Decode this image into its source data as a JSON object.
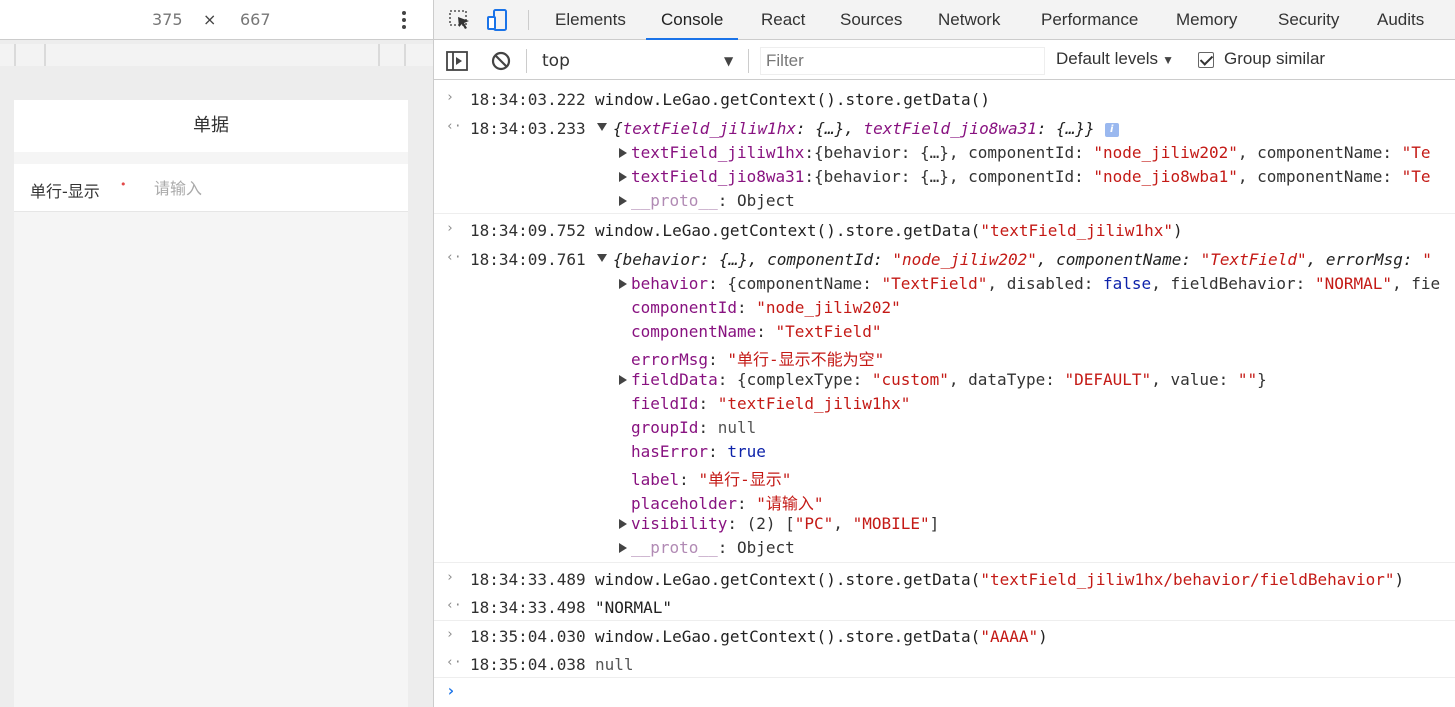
{
  "device": {
    "width": "375",
    "times": "×",
    "height": "667"
  },
  "app": {
    "header_title": "单据",
    "field_label": "单行-显示",
    "required_mark": "•",
    "field_placeholder": "请输入"
  },
  "devtools": {
    "tabs": [
      {
        "label": "Elements"
      },
      {
        "label": "Console"
      },
      {
        "label": "React"
      },
      {
        "label": "Sources"
      },
      {
        "label": "Network"
      },
      {
        "label": "Performance"
      },
      {
        "label": "Memory"
      },
      {
        "label": "Security"
      },
      {
        "label": "Audits"
      }
    ],
    "active_tab": "Console",
    "context": "top",
    "filter_placeholder": "Filter",
    "levels": "Default levels",
    "group_similar": "Group similar",
    "group_similar_checked": true
  },
  "console": {
    "entries": [
      {
        "in_time": "18:34:03.222",
        "command": "window.LeGao.getContext().store.getData()",
        "out_time": "18:34:03.233",
        "summary": [
          "{",
          "textField_jiliw1hx",
          ": {…}, ",
          "textField_jio8wa31",
          ": {…}}"
        ],
        "info": "i",
        "props": [
          {
            "key": "textField_jiliw1hx",
            "rest": ":{behavior: {…}, componentId: ",
            "str1": "\"node_jiliw202\"",
            "rest2": ", componentName: ",
            "str2": "\"Te"
          },
          {
            "key": "textField_jio8wa31",
            "rest": ":{behavior: {…}, componentId: ",
            "str1": "\"node_jio8wba1\"",
            "rest2": ", componentName: ",
            "str2": "\"Te"
          },
          {
            "key": "__proto__",
            "rest": ": Object"
          }
        ]
      },
      {
        "in_time": "18:34:09.752",
        "command": "window.LeGao.getContext().store.getData(",
        "command_arg": "\"textField_jiliw1hx\"",
        "command_end": ")",
        "out_time": "18:34:09.761",
        "summary": {
          "a": "{behavior: {…}, componentId: ",
          "b": "\"node_jiliw202\"",
          "c": ", componentName: ",
          "d": "\"TextField\"",
          "e": ", errorMsg: ",
          "f": "\""
        },
        "behavior": {
          "key": "behavior",
          "a": ": {componentName: ",
          "b": "\"TextField\"",
          "c": ", disabled: ",
          "d": "false",
          "e": ", fieldBehavior: ",
          "f": "\"NORMAL\"",
          "g": ", fie"
        },
        "componentId": {
          "key": "componentId",
          "val": "\"node_jiliw202\""
        },
        "componentName": {
          "key": "componentName",
          "val": "\"TextField\""
        },
        "errorMsg": {
          "key": "errorMsg",
          "val": "\"单行-显示不能为空\""
        },
        "fieldData": {
          "key": "fieldData",
          "a": ": {complexType: ",
          "b": "\"custom\"",
          "c": ", dataType: ",
          "d": "\"DEFAULT\"",
          "e": ", value: ",
          "f": "\"\"",
          "g": "}"
        },
        "fieldId": {
          "key": "fieldId",
          "val": "\"textField_jiliw1hx\""
        },
        "groupId": {
          "key": "groupId",
          "val": "null"
        },
        "hasError": {
          "key": "hasError",
          "val": "true"
        },
        "label": {
          "key": "label",
          "val": "\"单行-显示\""
        },
        "placeholder": {
          "key": "placeholder",
          "val": "\"请输入\""
        },
        "visibility": {
          "key": "visibility",
          "a": ": (2) [",
          "b": "\"PC\"",
          "c": ", ",
          "d": "\"MOBILE\"",
          "e": "]"
        },
        "proto": {
          "key": "__proto__",
          "rest": ": Object"
        }
      },
      {
        "in_time": "18:34:33.489",
        "command": "window.LeGao.getContext().store.getData(",
        "command_arg": "\"textField_jiliw1hx/behavior/fieldBehavior\"",
        "command_end": ")",
        "out_time": "18:34:33.498",
        "result": "\"NORMAL\""
      },
      {
        "in_time": "18:35:04.030",
        "command": "window.LeGao.getContext().store.getData(",
        "command_arg": "\"AAAA\"",
        "command_end": ")",
        "out_time": "18:35:04.038",
        "result": "null"
      }
    ],
    "in_glyph": "›",
    "out_glyph": "‹·",
    "prompt": "›"
  }
}
